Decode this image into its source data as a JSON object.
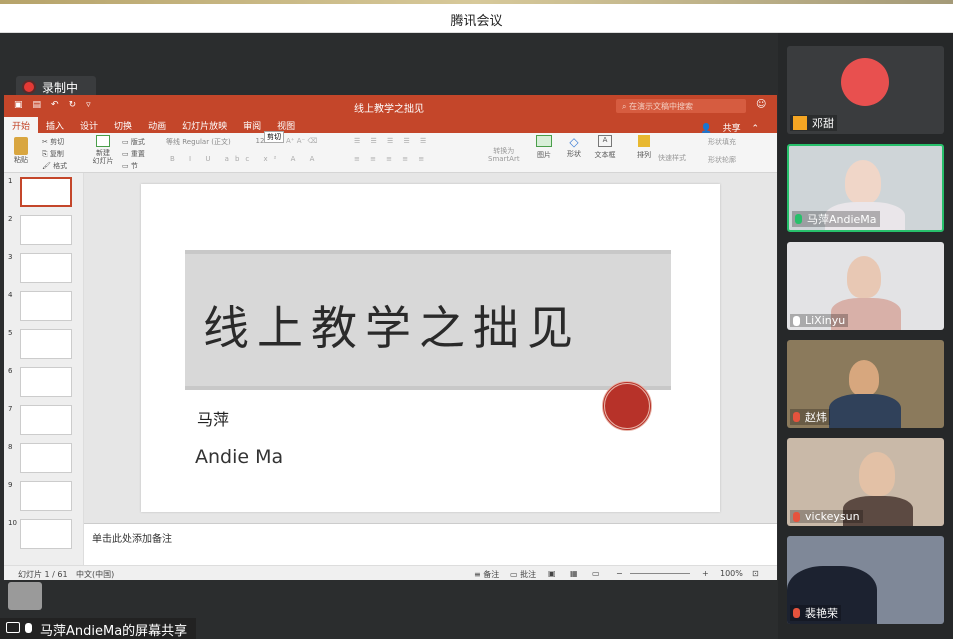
{
  "app": {
    "window_title": "腾讯会议",
    "recording_label": "录制中",
    "share_label": "马萍AndieMa的屏幕共享"
  },
  "ppt": {
    "doc_title": "线上教学之拙见",
    "search_placeholder": "在演示文稿中搜索",
    "share_button": "共享",
    "tabs": [
      "开始",
      "插入",
      "设计",
      "切换",
      "动画",
      "幻灯片放映",
      "审阅",
      "视图"
    ],
    "tooltip": "剪切",
    "ribbon": {
      "paste": "粘贴",
      "cut": "剪切",
      "copy": "复制",
      "format": "格式",
      "new_slide": "新建\n幻灯片",
      "layout": "版式",
      "reset": "重置",
      "section": "节",
      "font_name": "等线 Regular (正文)",
      "font_size": "12",
      "convert_smartart": "转换为\nSmartArt",
      "picture": "图片",
      "shapes": "形状",
      "textbox": "文本框",
      "arrange": "排列",
      "quick_styles": "快速样式",
      "shape_fill": "形状填充",
      "shape_outline": "形状轮廓"
    },
    "slide_numbers": [
      "1",
      "2",
      "3",
      "4",
      "5",
      "6",
      "7",
      "8",
      "9",
      "10"
    ],
    "slide": {
      "title": "线上教学之拙见",
      "author_cn": "马萍",
      "author_en": "Andie Ma"
    },
    "notes_placeholder": "单击此处添加备注",
    "status": {
      "slide_count": "幻灯片 1 / 61",
      "language": "中文(中国)",
      "notes": "备注",
      "comments": "批注",
      "zoom": "100%"
    }
  },
  "participants": [
    {
      "name": "邓甜"
    },
    {
      "name": "马萍AndieMa"
    },
    {
      "name": "LiXinyu"
    },
    {
      "name": "赵炜"
    },
    {
      "name": "vickeysun"
    },
    {
      "name": "裴艳荣"
    }
  ],
  "colors": {
    "accent": "#c4462a",
    "active_speaker": "#27c06b",
    "record": "#e53935"
  }
}
